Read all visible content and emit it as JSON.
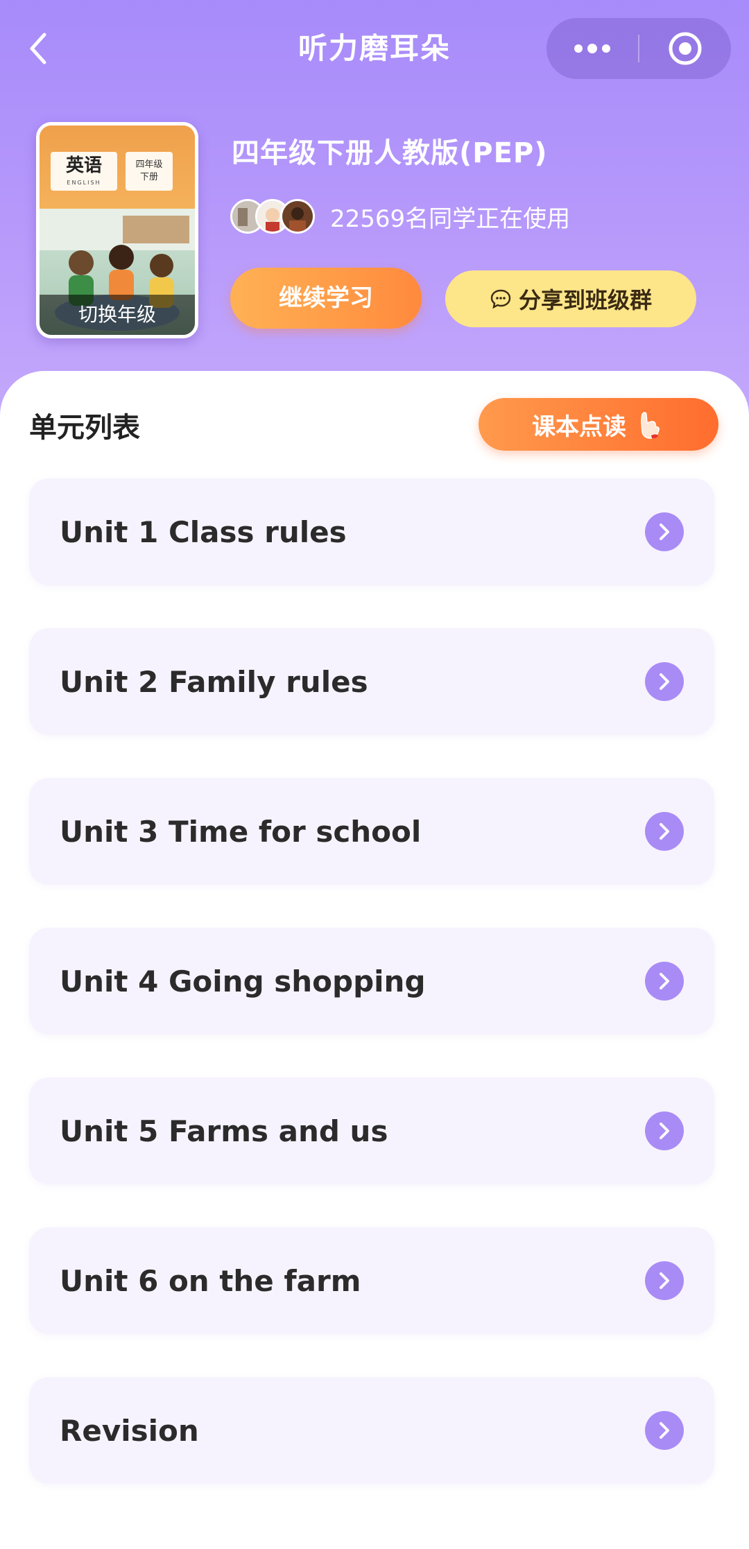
{
  "nav": {
    "title": "听力磨耳朵",
    "back_icon": "chevron-left-icon",
    "more_icon": "more-dots-icon",
    "close_icon": "target-circle-icon"
  },
  "book": {
    "cover_subject": "英语",
    "cover_subject_en": "ENGLISH",
    "cover_grade": "四年级",
    "cover_term": "下册",
    "switch_label": "切换年级",
    "title": "四年级下册人教版(PEP)",
    "users_text": "22569名同学正在使用"
  },
  "actions": {
    "continue_label": "继续学习",
    "share_label": "分享到班级群",
    "share_icon": "chat-bubble-icon"
  },
  "units_section": {
    "title": "单元列表",
    "read_button_label": "课本点读",
    "read_button_icon": "pointing-hand-icon",
    "items": [
      {
        "label": "Unit 1 Class rules"
      },
      {
        "label": "Unit 2 Family rules"
      },
      {
        "label": "Unit 3 Time for school"
      },
      {
        "label": "Unit 4 Going shopping"
      },
      {
        "label": "Unit 5 Farms and us"
      },
      {
        "label": "Unit 6 on the farm"
      },
      {
        "label": "Revision"
      }
    ]
  },
  "colors": {
    "header_purple": "#a78bfa",
    "continue_orange": "#ff8a3d",
    "share_yellow": "#fde58a",
    "arrow_purple": "#a98bf5",
    "item_bg": "#f6f3fe"
  }
}
